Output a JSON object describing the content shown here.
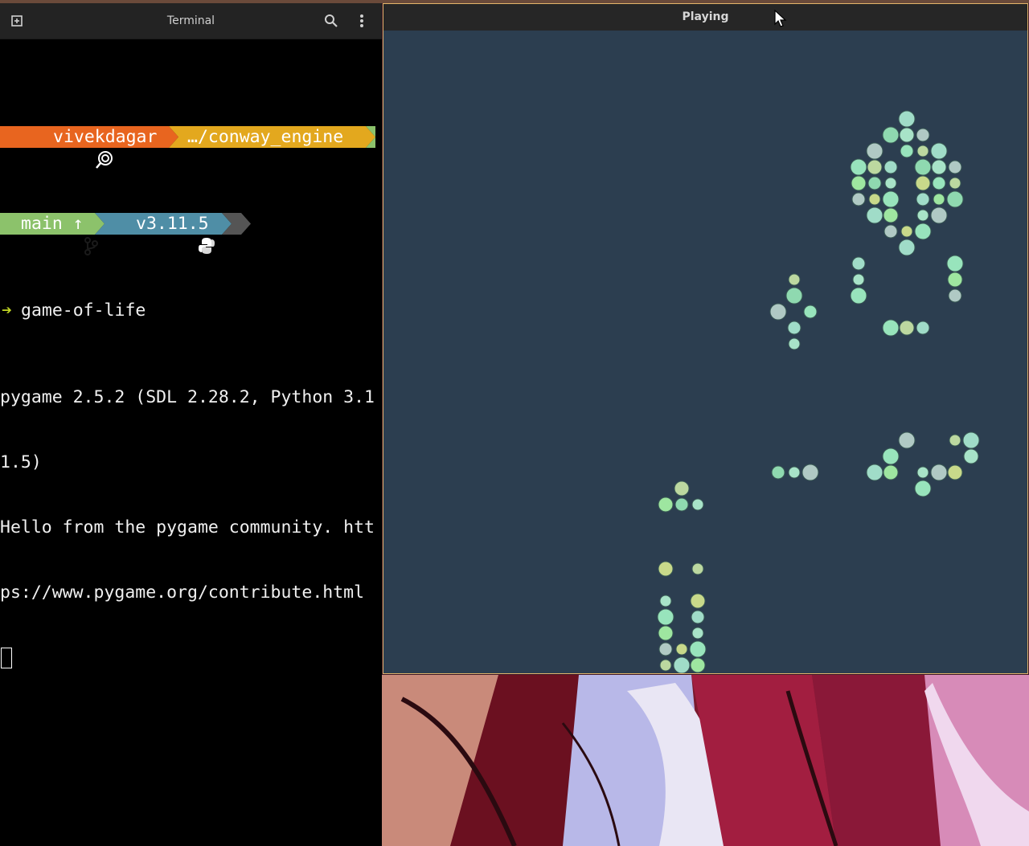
{
  "terminal": {
    "title": "Terminal",
    "icons": [
      "new-tab-icon",
      "search-icon",
      "menu-dots-icon"
    ],
    "prompt": {
      "os_icon": "lollipop-icon",
      "user": "vivekdagar",
      "path": "…/conway_engine",
      "branch_icon": "git-branch-icon",
      "branch": "main ↑",
      "python_icon": "python-icon",
      "python_version": "v3.11.5",
      "arrow": "➔",
      "command": "game-of-life"
    },
    "output": [
      "pygame 2.5.2 (SDL 2.28.2, Python 3.1",
      "1.5)",
      "Hello from the pygame community. htt",
      "ps://www.pygame.org/contribute.html"
    ],
    "colors": {
      "user_segment": "#e8651f",
      "path_segment": "#e3a81e",
      "branch_segment": "#8cc26b",
      "python_segment": "#4f8ea6",
      "end_segment": "#555555"
    }
  },
  "game": {
    "title": "Playing",
    "background": "#2c3e50",
    "cell_size": 20,
    "cells": [
      [
        32,
        5
      ],
      [
        31,
        6
      ],
      [
        32,
        6
      ],
      [
        33,
        6
      ],
      [
        30,
        7
      ],
      [
        32,
        7
      ],
      [
        33,
        7
      ],
      [
        34,
        7
      ],
      [
        29,
        8
      ],
      [
        30,
        8
      ],
      [
        31,
        8
      ],
      [
        33,
        8
      ],
      [
        34,
        8
      ],
      [
        35,
        8
      ],
      [
        29,
        9
      ],
      [
        30,
        9
      ],
      [
        31,
        9
      ],
      [
        33,
        9
      ],
      [
        34,
        9
      ],
      [
        35,
        9
      ],
      [
        29,
        10
      ],
      [
        30,
        10
      ],
      [
        31,
        10
      ],
      [
        33,
        10
      ],
      [
        34,
        10
      ],
      [
        35,
        10
      ],
      [
        30,
        11
      ],
      [
        31,
        11
      ],
      [
        33,
        11
      ],
      [
        34,
        11
      ],
      [
        31,
        12
      ],
      [
        32,
        12
      ],
      [
        33,
        12
      ],
      [
        32,
        13
      ],
      [
        29,
        14
      ],
      [
        35,
        14
      ],
      [
        29,
        15
      ],
      [
        35,
        15
      ],
      [
        29,
        16
      ],
      [
        35,
        16
      ],
      [
        25,
        15
      ],
      [
        25,
        16
      ],
      [
        24,
        17
      ],
      [
        26,
        17
      ],
      [
        25,
        18
      ],
      [
        25,
        19
      ],
      [
        31,
        18
      ],
      [
        32,
        18
      ],
      [
        33,
        18
      ],
      [
        32,
        25
      ],
      [
        35,
        25
      ],
      [
        36,
        25
      ],
      [
        31,
        26
      ],
      [
        36,
        26
      ],
      [
        24,
        27
      ],
      [
        25,
        27
      ],
      [
        26,
        27
      ],
      [
        30,
        27
      ],
      [
        31,
        27
      ],
      [
        33,
        27
      ],
      [
        34,
        27
      ],
      [
        35,
        27
      ],
      [
        33,
        28
      ],
      [
        18,
        28
      ],
      [
        17,
        29
      ],
      [
        18,
        29
      ],
      [
        19,
        29
      ],
      [
        17,
        33
      ],
      [
        19,
        33
      ],
      [
        17,
        35
      ],
      [
        19,
        35
      ],
      [
        17,
        36
      ],
      [
        19,
        36
      ],
      [
        17,
        37
      ],
      [
        19,
        37
      ],
      [
        17,
        38
      ],
      [
        18,
        38
      ],
      [
        19,
        38
      ],
      [
        17,
        39
      ],
      [
        18,
        39
      ],
      [
        19,
        39
      ]
    ],
    "cell_colors": [
      "#9ee6a0",
      "#8fd9b0",
      "#a8e3c8",
      "#b0c9c4",
      "#c8d98a",
      "#98e4bc",
      "#bcd8a0",
      "#a0dcc8"
    ]
  }
}
